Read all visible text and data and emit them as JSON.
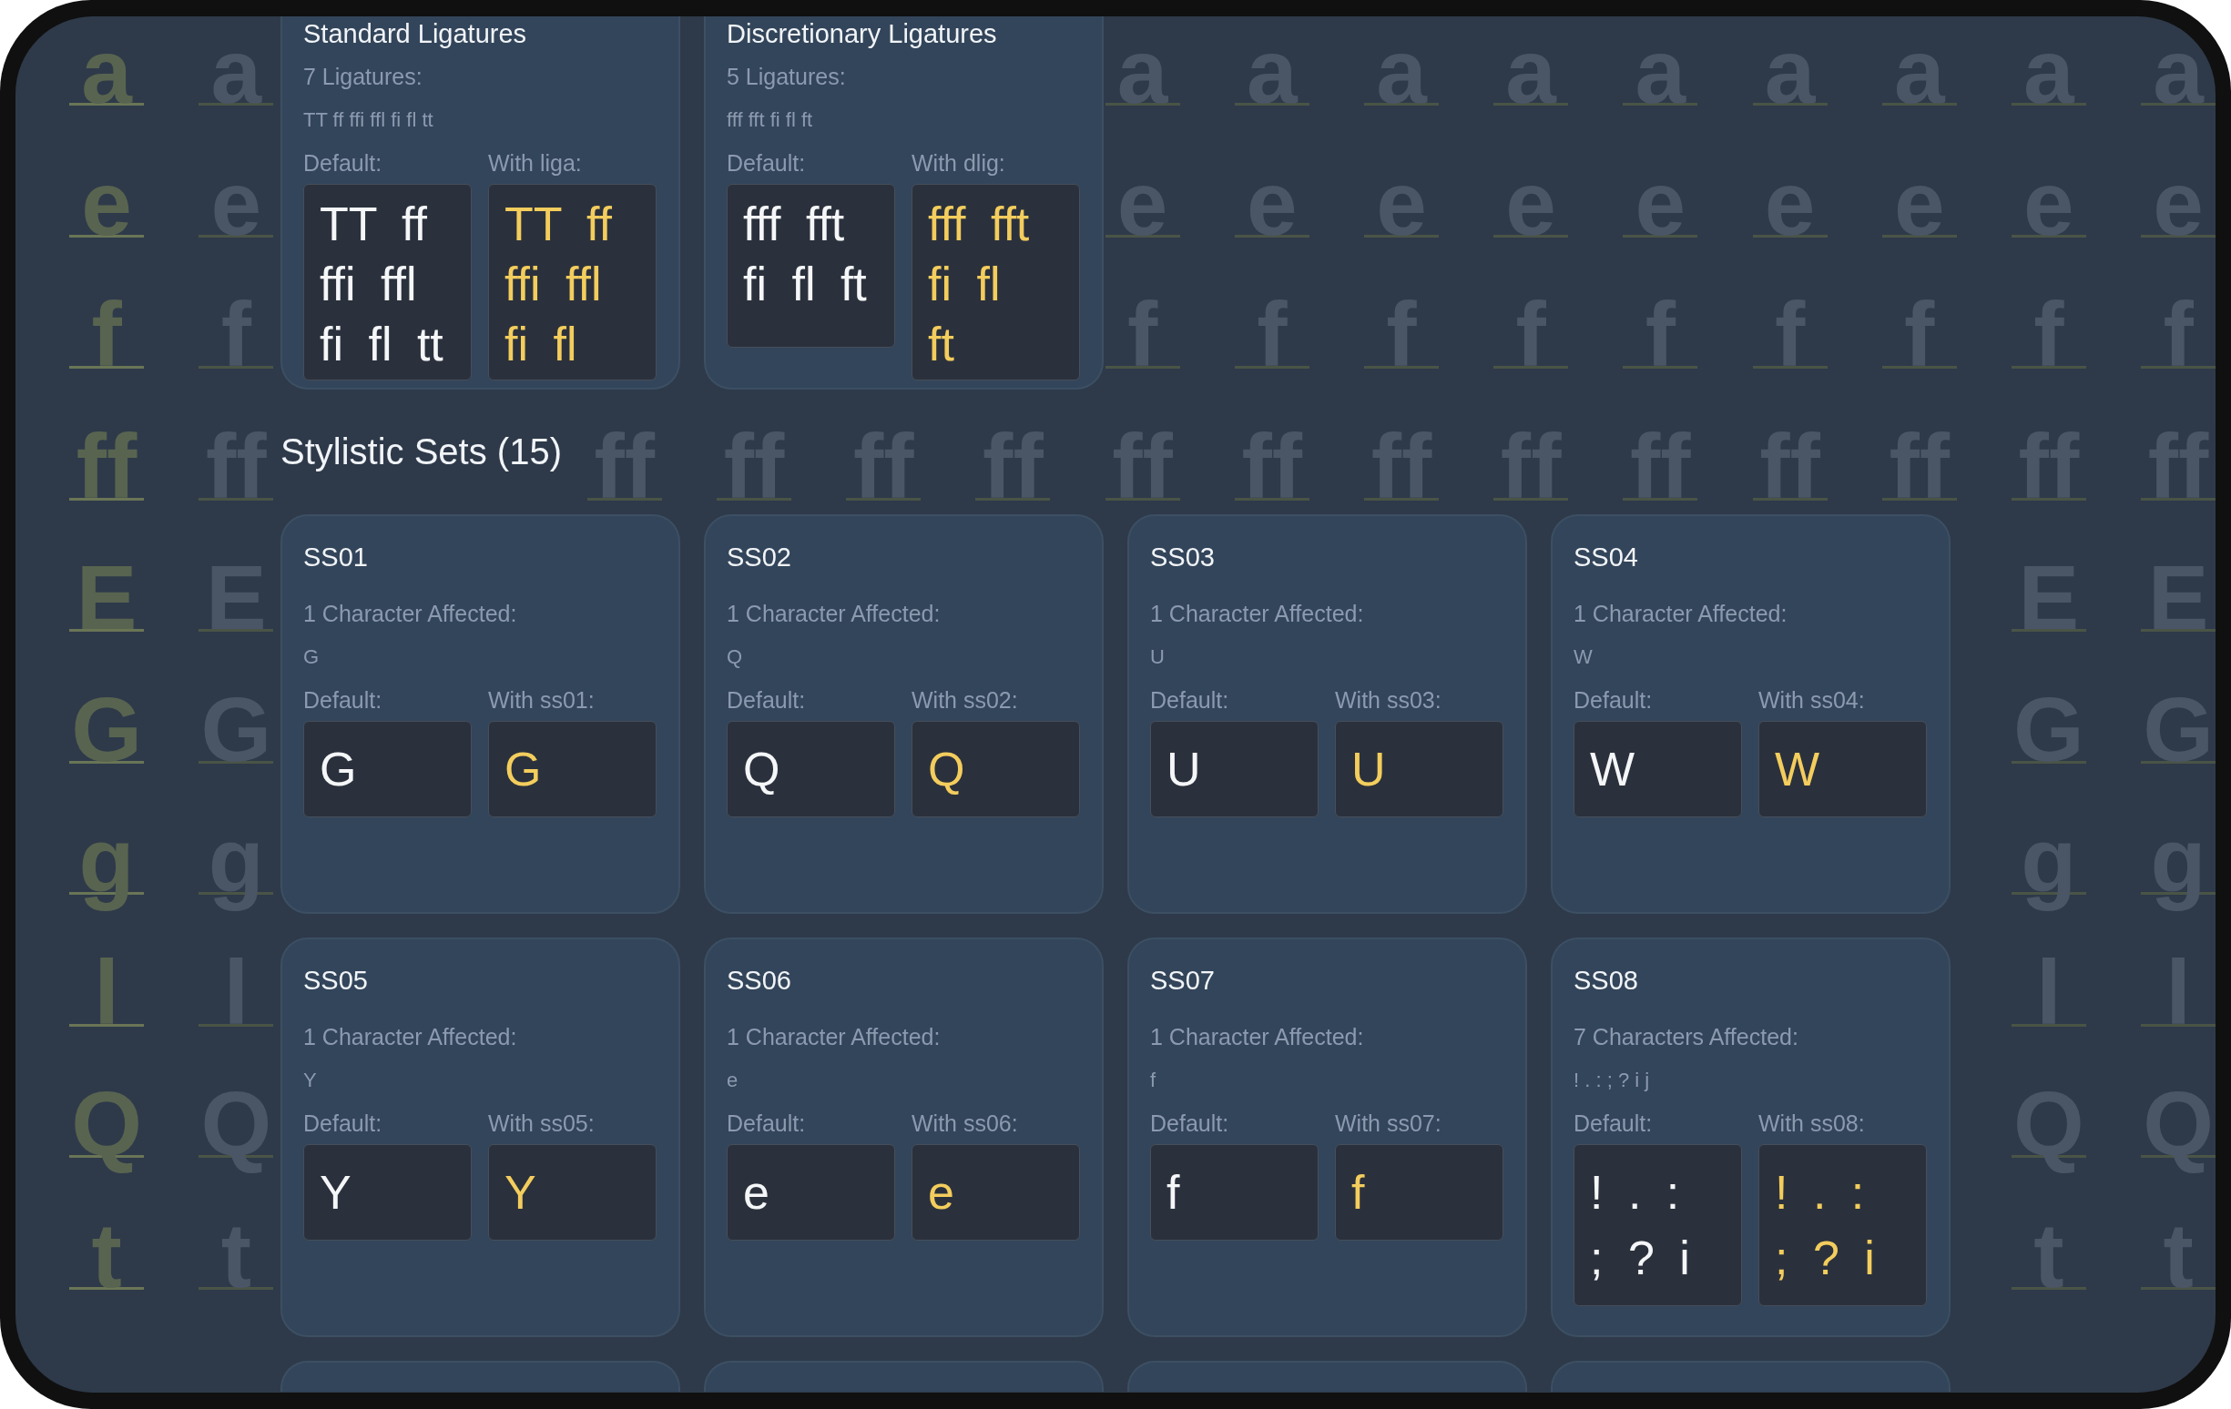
{
  "backdrop": {
    "rows": [
      {
        "key": "a",
        "left": [
          "a"
        ],
        "right": [
          "a",
          "a",
          "a",
          "a",
          "a",
          "a",
          "a",
          "a",
          "a"
        ]
      },
      {
        "key": "e",
        "left": [
          "e"
        ],
        "right": [
          "e",
          "e",
          "e",
          "e",
          "e",
          "e",
          "e",
          "e",
          "e"
        ]
      },
      {
        "key": "f",
        "left": [
          "f"
        ],
        "right": [
          "f",
          "f",
          "f",
          "f",
          "f",
          "f",
          "f",
          "f",
          "f"
        ]
      },
      {
        "key": "ff",
        "left": [
          "ff"
        ],
        "right": [
          "ff",
          "ff",
          "ff",
          "ff",
          "ff",
          "ff",
          "ff",
          "ff",
          "ff",
          "ff",
          "ff",
          "ff",
          "ff"
        ]
      },
      {
        "key": "E",
        "left": [
          "E"
        ],
        "right": [
          "E",
          "E"
        ]
      },
      {
        "key": "G",
        "left": [
          "G"
        ],
        "right": [
          "G",
          "G"
        ]
      },
      {
        "key": "g",
        "left": [
          "g"
        ],
        "right": [
          "g",
          "g"
        ]
      },
      {
        "key": "l",
        "left": [
          "l"
        ],
        "right": [
          "l",
          "l"
        ]
      },
      {
        "key": "Q",
        "left": [
          "Q"
        ],
        "right": [
          "Q",
          "Q"
        ]
      },
      {
        "key": "t",
        "left": [
          "t"
        ],
        "right": [
          "t",
          "t"
        ]
      }
    ]
  },
  "ligature_cards": [
    {
      "title": "Standard Ligatures",
      "count": "7 Ligatures:",
      "glyphs": "TT ff ffi ffl fi fl tt",
      "default_label": "Default:",
      "feature_label": "With liga:",
      "default_preview": [
        "TT ff",
        "ffi ffl",
        "fi fl tt"
      ],
      "feature_preview": [
        "TT ff",
        "ffi ffl",
        "fi fl"
      ]
    },
    {
      "title": "Discretionary Ligatures",
      "count": "5 Ligatures:",
      "glyphs": "fff fft fi fl ft",
      "default_label": "Default:",
      "feature_label": "With dlig:",
      "default_preview": [
        "fff fft",
        "fi fl ft"
      ],
      "feature_preview": [
        "fff fft",
        "fi fl",
        "ft"
      ]
    }
  ],
  "stylistic_sets": {
    "heading": "Stylistic Sets (15)",
    "cards": [
      {
        "title": "SS01",
        "count": "1 Character Affected:",
        "glyphs": "G",
        "default_label": "Default:",
        "feature_label": "With ss01:",
        "default_preview": [
          "G"
        ],
        "feature_preview": [
          "G"
        ]
      },
      {
        "title": "SS02",
        "count": "1 Character Affected:",
        "glyphs": "Q",
        "default_label": "Default:",
        "feature_label": "With ss02:",
        "default_preview": [
          "Q"
        ],
        "feature_preview": [
          "Q"
        ]
      },
      {
        "title": "SS03",
        "count": "1 Character Affected:",
        "glyphs": "U",
        "default_label": "Default:",
        "feature_label": "With ss03:",
        "default_preview": [
          "U"
        ],
        "feature_preview": [
          "U"
        ]
      },
      {
        "title": "SS04",
        "count": "1 Character Affected:",
        "glyphs": "W",
        "default_label": "Default:",
        "feature_label": "With ss04:",
        "default_preview": [
          "W"
        ],
        "feature_preview": [
          "W"
        ]
      },
      {
        "title": "SS05",
        "count": "1 Character Affected:",
        "glyphs": "Y",
        "default_label": "Default:",
        "feature_label": "With ss05:",
        "default_preview": [
          "Y"
        ],
        "feature_preview": [
          "Y"
        ]
      },
      {
        "title": "SS06",
        "count": "1 Character Affected:",
        "glyphs": "e",
        "default_label": "Default:",
        "feature_label": "With ss06:",
        "default_preview": [
          "e"
        ],
        "feature_preview": [
          "e"
        ]
      },
      {
        "title": "SS07",
        "count": "1 Character Affected:",
        "glyphs": "f",
        "default_label": "Default:",
        "feature_label": "With ss07:",
        "default_preview": [
          "f"
        ],
        "feature_preview": [
          "f"
        ]
      },
      {
        "title": "SS08",
        "count": "7 Characters Affected:",
        "glyphs": "! . : ; ? i j",
        "default_label": "Default:",
        "feature_label": "With ss08:",
        "default_preview": [
          "! . :",
          "; ? i"
        ],
        "feature_preview": [
          "! . :",
          "; ? i"
        ]
      }
    ],
    "continues_below": true
  }
}
